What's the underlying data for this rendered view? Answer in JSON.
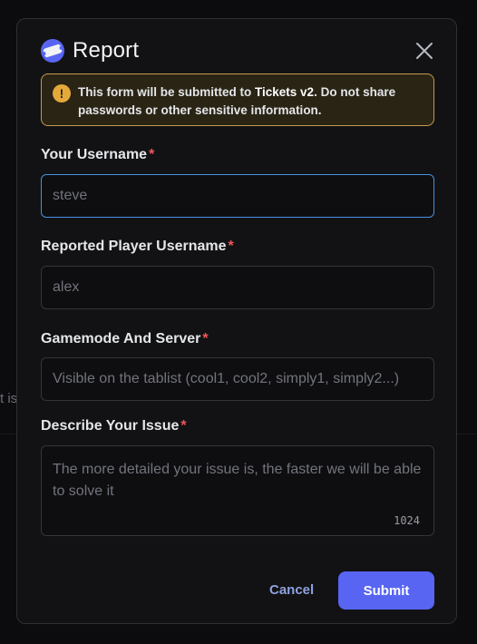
{
  "background": {
    "snippet": "t is"
  },
  "modal": {
    "app_icon": "ticket-app-icon",
    "title": "Report",
    "close_icon": "close-icon",
    "notice": {
      "icon": "exclamation-icon",
      "text_before": "This form will be submitted to ",
      "bot_name": "Tickets v2",
      "text_after": ". Do not share passwords or other sensitive information."
    },
    "fields": [
      {
        "label": "Your Username",
        "required_mark": "*",
        "value": "",
        "placeholder": "steve"
      },
      {
        "label": "Reported Player Username",
        "required_mark": "*",
        "value": "",
        "placeholder": "alex"
      },
      {
        "label": "Gamemode And Server",
        "required_mark": "*",
        "value": "",
        "placeholder": "Visible on the tablist (cool1, cool2, simply1, simply2...)"
      },
      {
        "label": "Describe Your Issue",
        "required_mark": "*",
        "value": "",
        "placeholder": "The more detailed your issue is, the faster we will be able to solve it",
        "char_limit": "1024"
      }
    ],
    "cancel_label": "Cancel",
    "submit_label": "Submit"
  },
  "colors": {
    "accent": "#5865f2",
    "notice_border": "#c59a4f",
    "required": "#f2555a",
    "focus_border": "#4a90e2"
  }
}
